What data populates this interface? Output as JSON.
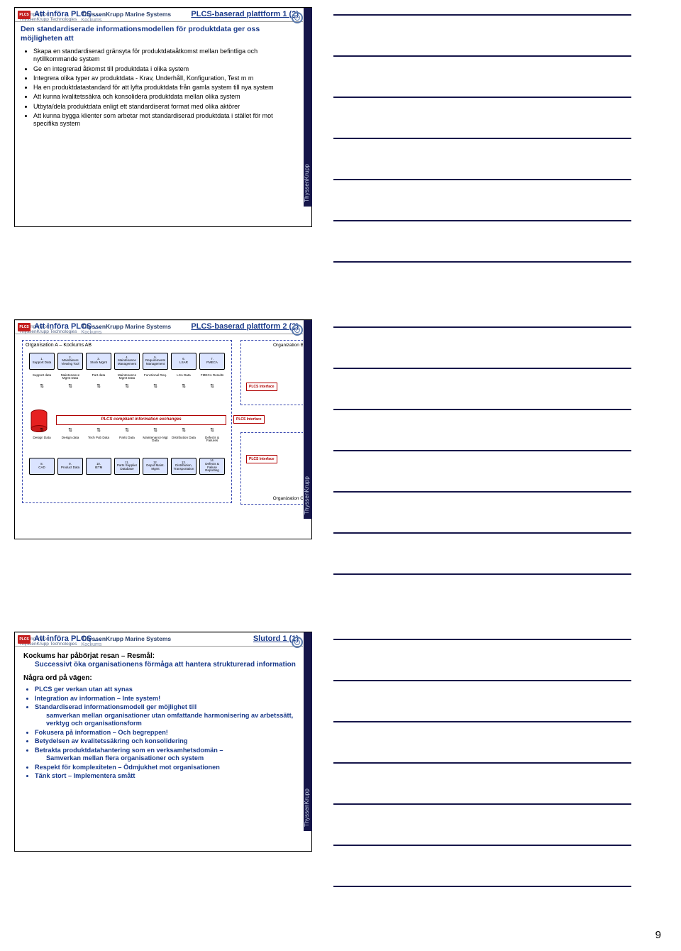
{
  "page_number": "9",
  "brand": {
    "company_of": "A Company of",
    "tech": "ThyssenKrupp Technologies",
    "main": "ThyssenKrupp Marine Systems",
    "sub": "Kockums",
    "side": "ThyssenKrupp"
  },
  "badge": "PLCS",
  "slide1": {
    "title_left": "Att införa PLCS …",
    "title_right": "PLCS-baserad plattform 1 (2)",
    "subhead": "Den standardiserade informationsmodellen för produktdata ger oss möjligheten att",
    "bullets": [
      "Skapa en standardiserad gränsyta för produktdataåtkomst mellan befintliga och nytillkommande system",
      "Ge en integrerad åtkomst till produktdata i olika system",
      "Integrera olika typer av produktdata - Krav, Underhåll, Konfiguration, Test m m",
      "Ha en produktdatastandard för att lyfta produktdata från gamla system till nya system",
      "Att kunna kvalitetssäkra och konsolidera produktdata mellan olika system",
      "Utbyta/dela produktdata enligt ett standardiserat format med olika aktörer",
      "Att kunna bygga klienter som arbetar mot standardiserad produktdata i stället för mot specifika system"
    ]
  },
  "slide2": {
    "title_left": "Att införa PLCS …",
    "title_right": "PLCS-baserad plattform 2 (2)",
    "orgA": "Organisation A – Kockums AB",
    "orgB": "Organization B",
    "orgC": "Organization C",
    "bus": "PLCS compliant information exchanges",
    "plcs_if": "PLCS Interface",
    "row1_apps": [
      {
        "n": "1.",
        "t": "Support Data"
      },
      {
        "n": "2.",
        "t": "Maintainers Viewing Tool"
      },
      {
        "n": "3.",
        "t": "Stock Mgmt"
      },
      {
        "n": "4.",
        "t": "Maintenance Management"
      },
      {
        "n": "5.",
        "t": "Requirements Management"
      },
      {
        "n": "6.",
        "t": "LSAR"
      },
      {
        "n": "7.",
        "t": "FMECA"
      }
    ],
    "row1_labels": [
      "Support data",
      "Maintenance Mgmt Data",
      "Part data",
      "Maintenance Mgmt Data",
      "Functional Req.",
      "LSA Data",
      "FMECA Results"
    ],
    "row2_labels": [
      "Design Data",
      "Design data",
      "Tech Pub Data",
      "Parts Data",
      "Maintenance Mgt Data",
      "Distribution Data",
      "Defects & Failures"
    ],
    "row2_apps": [
      {
        "n": "8.",
        "t": "CAD"
      },
      {
        "n": "9.",
        "t": "Product Data"
      },
      {
        "n": "10.",
        "t": "IETM"
      },
      {
        "n": "11.",
        "t": "Parts Supplier Database"
      },
      {
        "n": "12.",
        "t": "Depot Maint. Mgmt"
      },
      {
        "n": "13.",
        "t": "Distribution, Transportation"
      },
      {
        "n": "14.",
        "t": "Defects & Failure Reporting"
      }
    ]
  },
  "slide3": {
    "title_left": "Att införa PLCS …",
    "title_right": "Slutord 1 (1)",
    "lead": "Kockums har påbörjat resan – Resmål:",
    "goal": "Successivt öka organisationens förmåga att hantera strukturerad information",
    "sect": "Några ord på vägen:",
    "bullets": [
      "PLCS ger verkan utan att synas",
      "Integration av information – Inte system!",
      "Standardiserad informationsmodell ger möjlighet till",
      "Fokusera på information – Och begreppen!",
      "Betydelsen av kvalitetssäkring och konsolidering",
      "Betrakta produktdatahantering som en verksamhetsdomän –",
      "Respekt för komplexiteten – Ödmjukhet mot organisationen",
      "Tänk stort – Implementera smått"
    ],
    "sub3": "samverkan mellan organisationer utan omfattande harmonisering av arbetssätt, verktyg och organisationsform",
    "sub6": "Samverkan mellan flera organisationer och system"
  }
}
